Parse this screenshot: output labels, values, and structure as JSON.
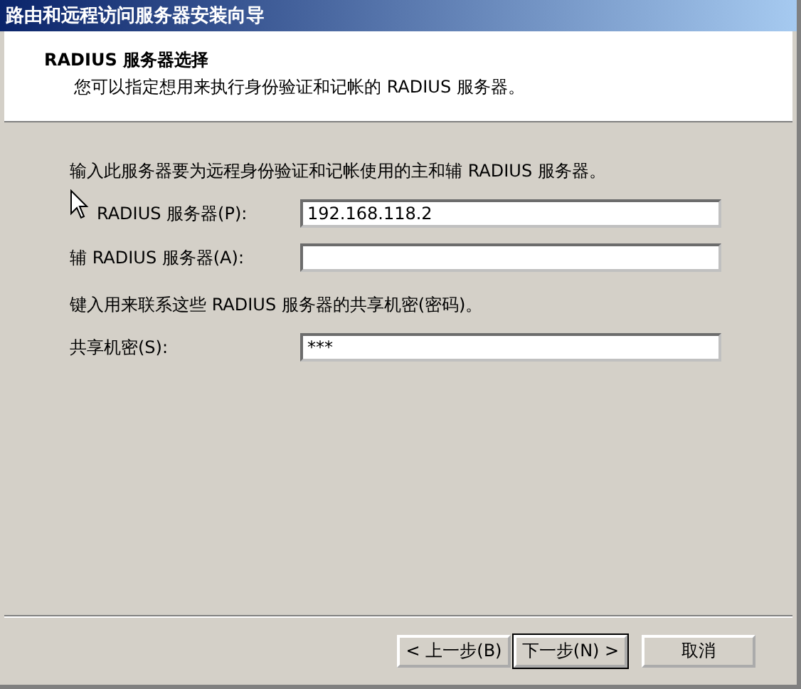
{
  "window": {
    "title": "路由和远程访问服务器安装向导"
  },
  "header": {
    "title": "RADIUS 服务器选择",
    "subtitle": "您可以指定想用来执行身份验证和记帐的 RADIUS 服务器。"
  },
  "intro": "输入此服务器要为远程身份验证和记帐使用的主和辅 RADIUS 服务器。",
  "fields": [
    {
      "label": "RADIUS 服务器(P):",
      "value": "192.168.118.2"
    },
    {
      "label": "辅 RADIUS 服务器(A):"
    }
  ],
  "secret_note": "键入用来联系这些 RADIUS 服务器的共享机密(密码)。",
  "secret": {
    "label": "共享机密(S):",
    "value": "***"
  },
  "buttons": [
    {
      "label": "< 上一步(B)",
      "selected": false
    },
    {
      "label": "下一步(N) >",
      "selected": true
    },
    {
      "label": "取消",
      "selected": false
    }
  ]
}
